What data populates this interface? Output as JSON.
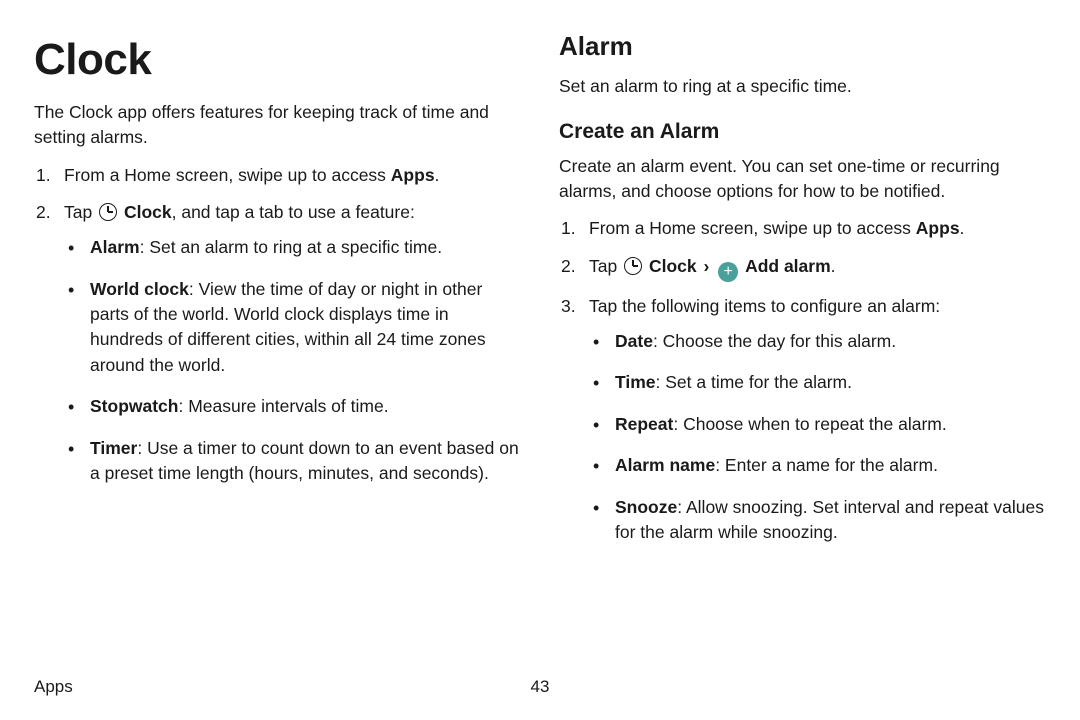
{
  "left": {
    "title": "Clock",
    "intro": "The Clock app offers features for keeping track of time and setting alarms.",
    "steps": {
      "s1": {
        "lead": "From a Home screen, swipe up to access ",
        "bold": "Apps",
        "tail": "."
      },
      "s2": {
        "lead": "Tap ",
        "bold": "Clock",
        "tail": ", and tap a tab to use a feature:"
      }
    },
    "features": {
      "alarm": {
        "name": "Alarm",
        "desc": ": Set an alarm to ring at a specific time."
      },
      "world": {
        "name": "World clock",
        "desc": ": View the time of day or night in other parts of the world. World clock displays time in hundreds of different cities, within all 24 time zones around the world."
      },
      "stopwatch": {
        "name": "Stopwatch",
        "desc": ": Measure intervals of time."
      },
      "timer": {
        "name": "Timer",
        "desc": ": Use a timer to count down to an event based on a preset time length (hours, minutes, and seconds)."
      }
    }
  },
  "right": {
    "title": "Alarm",
    "intro": "Set an alarm to ring at a specific time.",
    "create_title": "Create an Alarm",
    "create_intro": "Create an alarm event. You can set one-time or recurring alarms, and choose options for how to be notified.",
    "steps": {
      "s1": {
        "lead": "From a Home screen, swipe up to access ",
        "bold": "Apps",
        "tail": "."
      },
      "s2": {
        "lead": "Tap ",
        "clock_bold": "Clock",
        "chev": "›",
        "add_bold": "Add alarm",
        "tail": "."
      },
      "s3": {
        "text": "Tap the following items to configure an alarm:"
      }
    },
    "config": {
      "date": {
        "name": "Date",
        "desc": ": Choose the day for this alarm."
      },
      "time": {
        "name": "Time",
        "desc": ": Set a time for the alarm."
      },
      "repeat": {
        "name": "Repeat",
        "desc": ": Choose when to repeat the alarm."
      },
      "aname": {
        "name": "Alarm name",
        "desc": ": Enter a name for the alarm."
      },
      "snooze": {
        "name": "Snooze",
        "desc": ": Allow snoozing. Set interval and repeat values for the alarm while snoozing."
      }
    }
  },
  "footer": {
    "section": "Apps",
    "page": "43"
  }
}
